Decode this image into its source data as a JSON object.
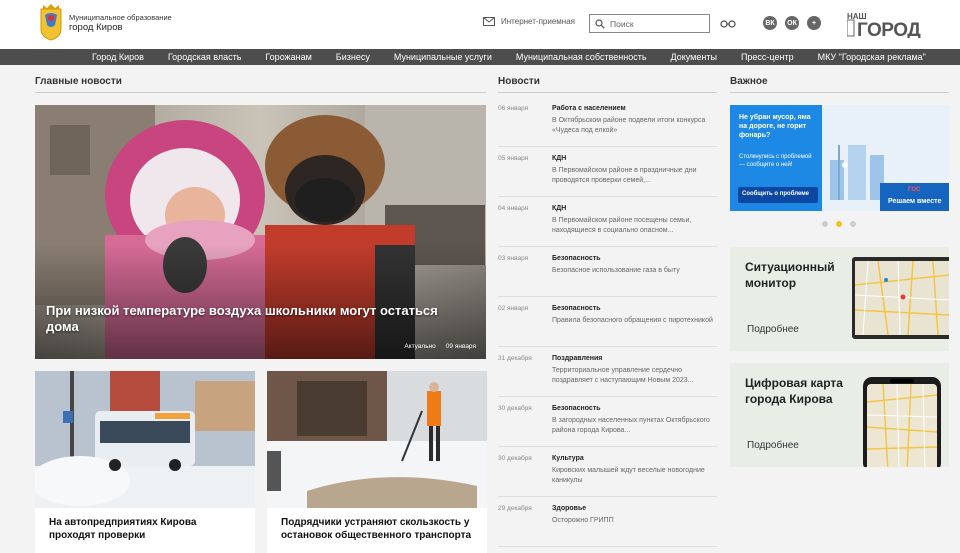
{
  "header": {
    "logo_line1": "Муниципальное образование",
    "logo_line2": "город Киров",
    "reception": "Интернет-приемная",
    "search_placeholder": "Поиск",
    "socials": [
      "ВК",
      "ОК",
      "+"
    ],
    "partner_logo": "НАШ ГОРОД"
  },
  "nav": {
    "items": [
      "Город Киров",
      "Городская власть",
      "Горожанам",
      "Бизнесу",
      "Муниципальные услуги",
      "Муниципальная собственность",
      "Документы",
      "Пресс-центр",
      "МКУ \"Городская реклама\""
    ]
  },
  "sections": {
    "main": "Главные новости",
    "news": "Новости",
    "important": "Важное"
  },
  "main_news": {
    "title": "При низкой температуре воздуха школьники могут остаться дома",
    "tag": "Актуально",
    "date": "09 января"
  },
  "cards": [
    {
      "title": "На автопредприятиях Кирова проходят проверки"
    },
    {
      "title": "Подрядчики устраняют скользкость у остановок общественного транспорта"
    }
  ],
  "news": [
    {
      "date": "06 января",
      "category": "Работа с населением",
      "text": "В Октябрьском районе подвели итоги конкурса «Чудеса под елкой»"
    },
    {
      "date": "05 января",
      "category": "КДН",
      "text": "В Первомайском районе в праздничные дни проводятся проверки семей,..."
    },
    {
      "date": "04 января",
      "category": "КДН",
      "text": "В Первомайском районе посещены семьи, находящиеся в социально опасном..."
    },
    {
      "date": "03 января",
      "category": "Безопасность",
      "text": "Безопасное использование газа в быту"
    },
    {
      "date": "02 января",
      "category": "Безопасность",
      "text": "Правила безопасного обращения с пиротехникой"
    },
    {
      "date": "31 декабря",
      "category": "Поздравления",
      "text": "Территориальное управление сердечно поздравляет с наступающим Новым 2023..."
    },
    {
      "date": "30 декабря",
      "category": "Безопасность",
      "text": "В загородных населенных пунктах Октябрьского района города Кирова..."
    },
    {
      "date": "30 декабря",
      "category": "Культура",
      "text": "Кировских малышей ждут веселые новогодние каникулы"
    },
    {
      "date": "29 декабря",
      "category": "Здоровье",
      "text": "Осторожно ГРИПП"
    }
  ],
  "banner": {
    "headline": "Не убран мусор, яма на дороге, не горит фонарь?",
    "sub": "Столкнулись с проблемой — сообщите о ней!",
    "button": "Сообщить о проблеме",
    "brand_top": "ГОС",
    "brand_bottom": "Решаем вместе"
  },
  "carousel": {
    "total": 3,
    "active": 2
  },
  "promos": [
    {
      "title": "Ситуационный монитор",
      "more": "Подробнее"
    },
    {
      "title": "Цифровая карта города Кирова",
      "more": "Подробнее"
    }
  ],
  "colors": {
    "nav_bg": "#4d4d4d",
    "accent": "#f0c419",
    "banner_blue": "#1e88e5"
  }
}
